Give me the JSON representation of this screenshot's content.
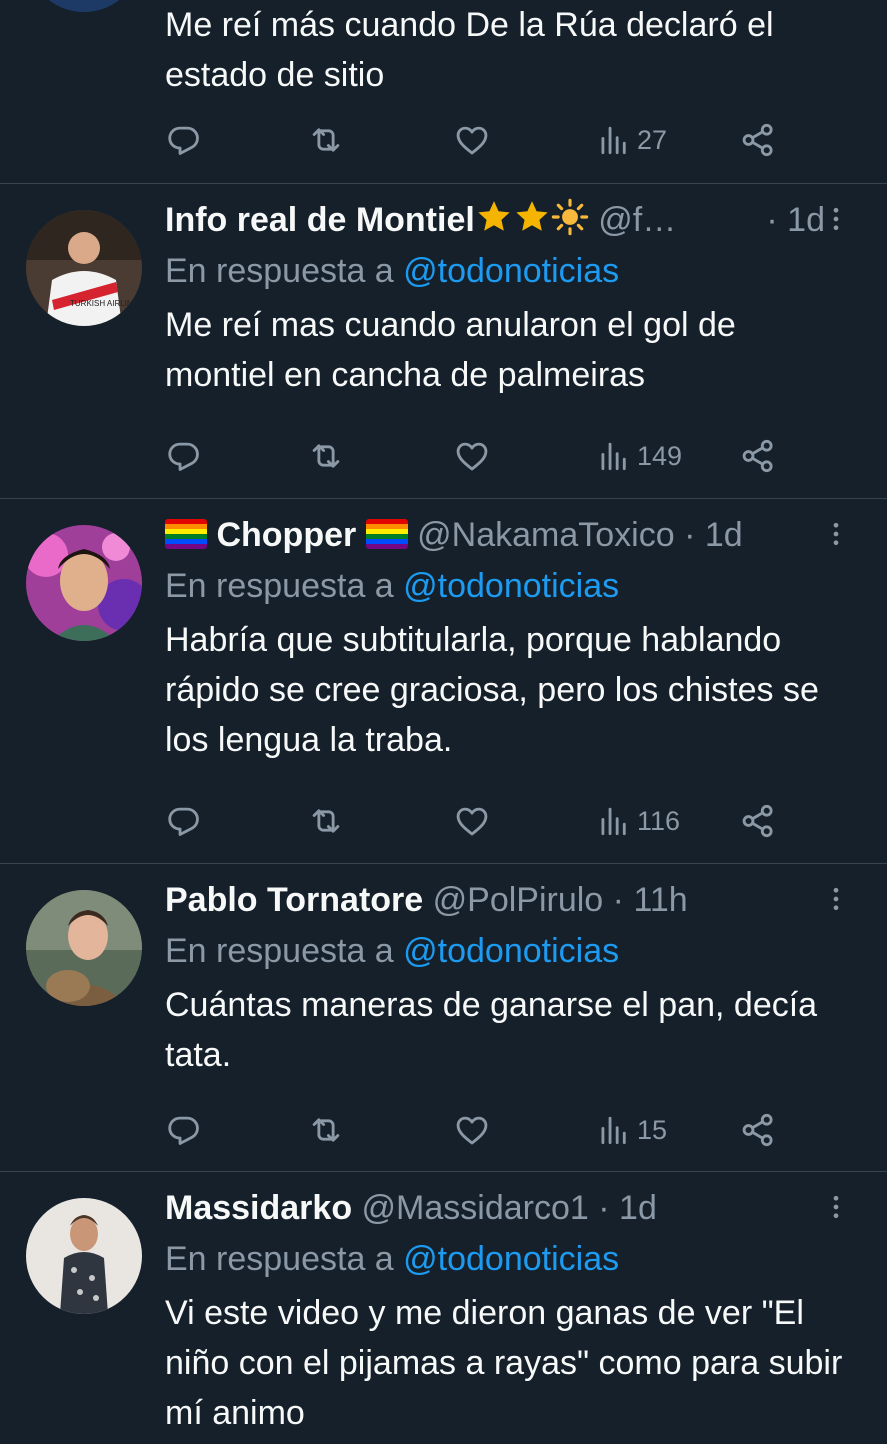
{
  "tweets": [
    {
      "text": "Me reí más cuando De la Rúa declaró el estado de sitio",
      "stats": {
        "views": "27"
      }
    },
    {
      "name": "Info real de Montiel",
      "name_emojis": [
        "star",
        "star",
        "sun"
      ],
      "handle": "@f…",
      "time": "· 1d",
      "reply_label": "En respuesta a",
      "reply_mention": "@todonoticias",
      "text": "Me reí mas cuando anularon el gol de montiel en cancha de palmeiras",
      "stats": {
        "views": "149"
      },
      "avatar_text": "TURKISH AIRLINES"
    },
    {
      "name": "Chopper",
      "name_emojis": [
        "rainbow-flag",
        "rainbow-flag"
      ],
      "handle": "@NakamaToxico",
      "time": "· 1d",
      "reply_label": "En respuesta a",
      "reply_mention": "@todonoticias",
      "text": "Habría que subtitularla, porque hablando rápido se cree graciosa, pero los chistes se los lengua la traba.",
      "stats": {
        "views": "116"
      }
    },
    {
      "name": "Pablo Tornatore",
      "handle": "@PolPirulo",
      "time": "· 11h",
      "reply_label": "En respuesta a",
      "reply_mention": "@todonoticias",
      "text": "Cuántas maneras de ganarse el pan, decía tata.",
      "stats": {
        "views": "15"
      }
    },
    {
      "name": "Massidarko",
      "handle": "@Massidarco1",
      "time": "· 1d",
      "reply_label": "En respuesta a",
      "reply_mention": "@todonoticias",
      "text": "Vi este video y me dieron ganas de ver \"El niño con el pijamas a rayas\"  como para subir mí animo"
    }
  ],
  "colors": {
    "background": "#15202b",
    "divider": "#38444d",
    "secondary_text": "#8b98a5",
    "link": "#1d9bf0"
  },
  "icons": [
    "reply-icon",
    "retweet-icon",
    "like-icon",
    "views-icon",
    "share-icon",
    "more-icon"
  ]
}
